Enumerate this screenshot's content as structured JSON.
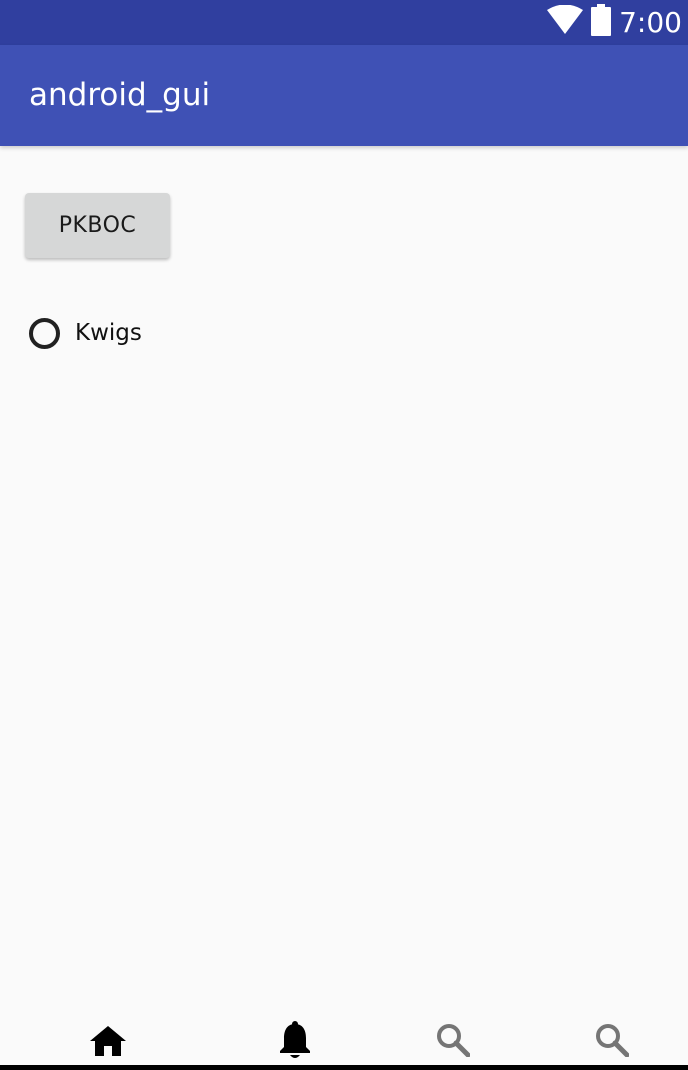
{
  "status_bar": {
    "time": "7:00",
    "icons": [
      "wifi-icon",
      "battery-icon"
    ],
    "background": "#303f9f"
  },
  "app_bar": {
    "title": "android_gui",
    "background": "#3f51b5"
  },
  "content": {
    "button_label": "PKBOC",
    "radio": {
      "label": "Kwigs",
      "checked": false
    }
  },
  "bottom_nav": {
    "items": [
      {
        "icon": "home-icon",
        "color": "#000000"
      },
      {
        "icon": "bell-icon",
        "color": "#000000"
      },
      {
        "icon": "search-icon",
        "color": "#757575"
      },
      {
        "icon": "search-icon",
        "color": "#757575"
      }
    ]
  }
}
